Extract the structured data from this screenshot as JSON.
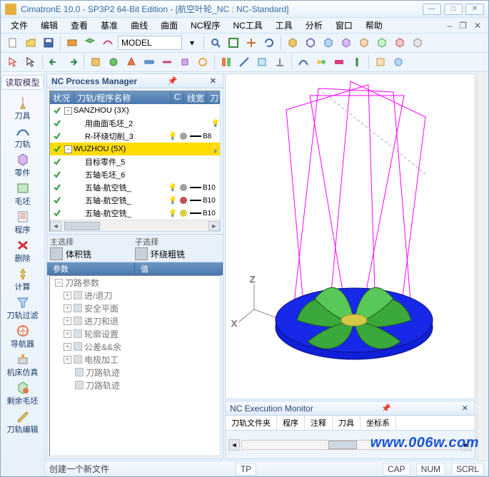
{
  "title": "CimatronE 10.0 - SP3P2 64-Bit Edition - [航空叶轮_NC : NC-Standard]",
  "menu": [
    "文件",
    "编辑",
    "查看",
    "基准",
    "曲线",
    "曲面",
    "NC程序",
    "NC工具",
    "工具",
    "分析",
    "窗口",
    "帮助"
  ],
  "combo": "MODEL",
  "sidebar_tab": "读取模型",
  "sidebar": [
    "刀具",
    "刀轨",
    "零件",
    "毛坯",
    "程序",
    "删除",
    "计算",
    "刀轨过滤",
    "导航器",
    "机床仿真",
    "剩余毛坯",
    "刀轨编辑"
  ],
  "nc_pm_title": "NC Process Manager",
  "tree_hdr": {
    "c1": "状况",
    "c2": "刀轨/程序名称",
    "c3": "C",
    "c4": "线宽",
    "c5": "刀"
  },
  "tree": [
    {
      "lvl": 0,
      "exp": "-",
      "name": "SANZHOU (3X)",
      "chk": true
    },
    {
      "lvl": 1,
      "name": "用曲面毛坯_2",
      "chk": true,
      "bulb": true
    },
    {
      "lvl": 1,
      "name": "R-环绕切削_3",
      "chk": true,
      "bulb": true,
      "dot": "#a0a0a0",
      "bar": true,
      "bc": "B8"
    },
    {
      "lvl": 0,
      "exp": "-",
      "name": "WUZHOU (5X)",
      "chk": true,
      "sel": true,
      "bulb": true
    },
    {
      "lvl": 1,
      "name": "目标零件_5",
      "chk": true
    },
    {
      "lvl": 1,
      "name": "五轴毛坯_6",
      "chk": true
    },
    {
      "lvl": 1,
      "name": "五轴-航空铣_",
      "chk": true,
      "bulb": true,
      "dot": "#a0a0a0",
      "bar": true,
      "bc": "B10"
    },
    {
      "lvl": 1,
      "name": "五轴-航空铣_",
      "chk": true,
      "bulb": true,
      "dot": "#c05050",
      "bar": true,
      "bc": "B10"
    },
    {
      "lvl": 1,
      "name": "五轴-航空铣_",
      "chk": true,
      "bulb": true,
      "dot": "#d8d040",
      "bar": true,
      "bc": "B10"
    }
  ],
  "sel_main_lbl": "主选择",
  "sel_main_val": "体积铣",
  "sel_sub_lbl": "子选择",
  "sel_sub_val": "环绕粗铣",
  "param_hdr": [
    "参数",
    "值"
  ],
  "params": [
    {
      "exp": "-",
      "name": "刀路参数",
      "lvl": 0
    },
    {
      "exp": "+",
      "name": "进/退刀",
      "lvl": 1,
      "pic": true
    },
    {
      "exp": "+",
      "name": "安全平面",
      "lvl": 1,
      "pic": true
    },
    {
      "exp": "+",
      "name": "进刀和退",
      "lvl": 1,
      "pic": true
    },
    {
      "exp": "+",
      "name": "轮廓设置",
      "lvl": 1,
      "pic": true
    },
    {
      "exp": "+",
      "name": "公差&&余",
      "lvl": 1,
      "pic": true
    },
    {
      "exp": "+",
      "name": "电极加工",
      "lvl": 1,
      "pic": true
    },
    {
      "name": "刀路轨迹",
      "lvl": 1,
      "pic": true
    },
    {
      "name": "刀路轨迹",
      "lvl": 1,
      "pic": true
    }
  ],
  "exec_title": "NC Execution Monitor",
  "exec_tabs": [
    "刀轨文件夹",
    "程序",
    "注释",
    "刀具",
    "坐标系"
  ],
  "status_msg": "创建一个新文件",
  "status_tp": "TP",
  "status_caps": [
    "CAP",
    "NUM",
    "SCRL"
  ],
  "watermark": "www.006w.com"
}
